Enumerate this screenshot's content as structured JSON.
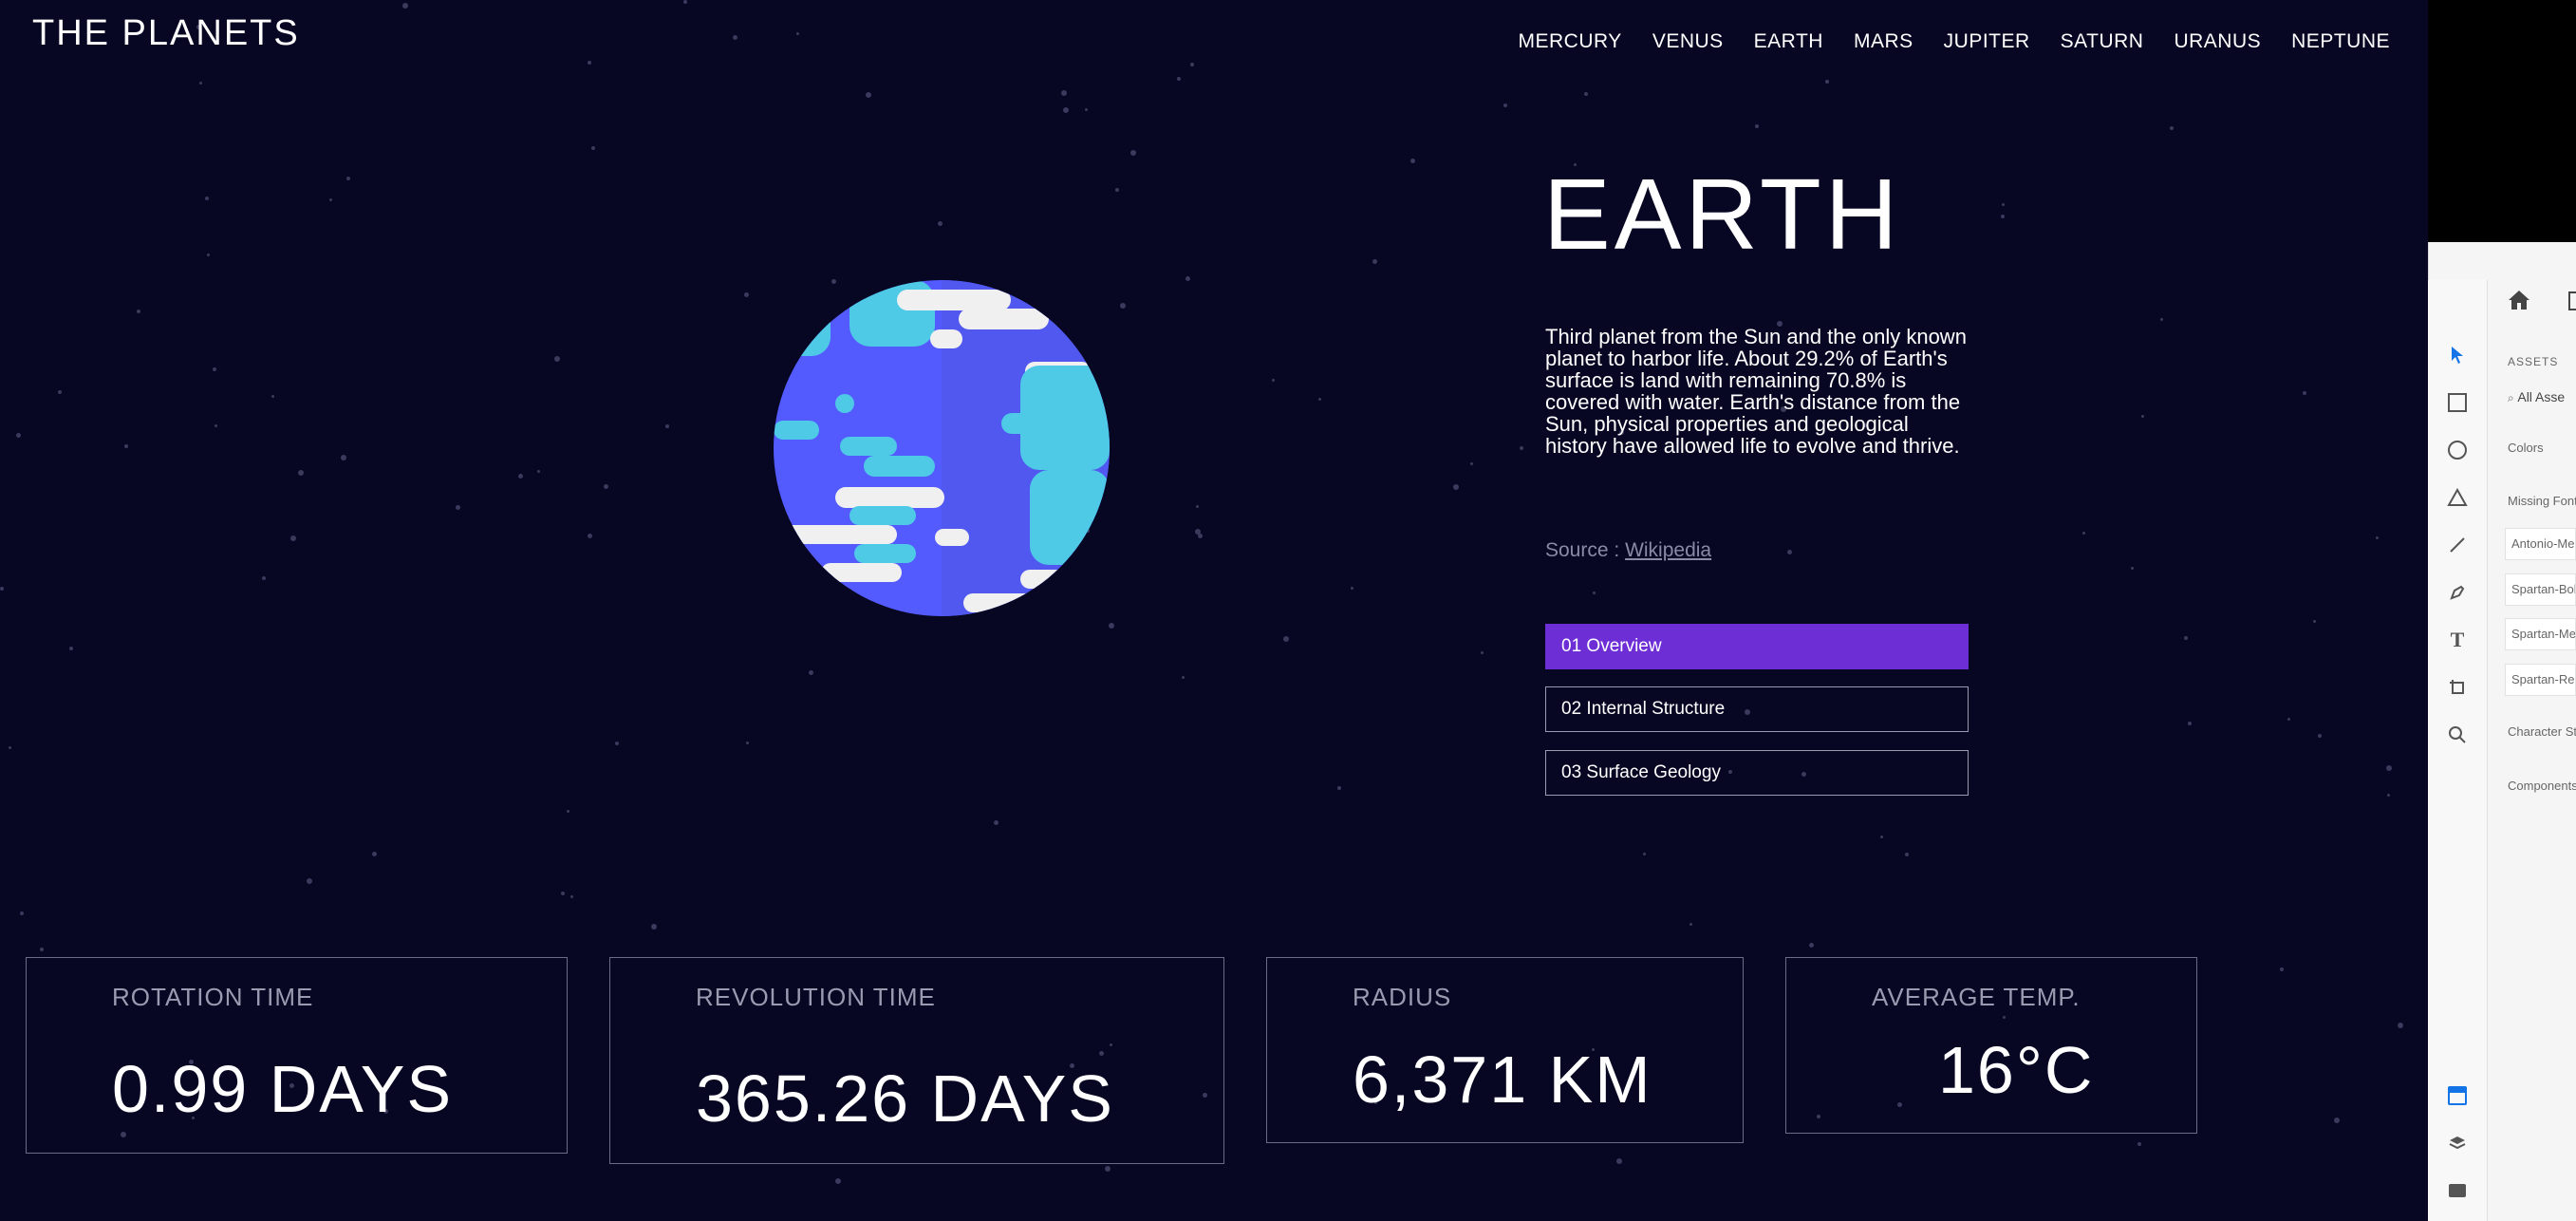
{
  "app": {
    "logo": "THE PLANETS",
    "nav": [
      "MERCURY",
      "VENUS",
      "EARTH",
      "MARS",
      "JUPITER",
      "SATURN",
      "URANUS",
      "NEPTUNE"
    ]
  },
  "planet": {
    "name": "EARTH",
    "description": "Third planet from the Sun and the only known planet to harbor life. About 29.2% of Earth's surface is land with remaining 70.8% is covered with water. Earth's distance from the Sun, physical properties and geological history have allowed life to evolve and thrive.",
    "source_label": "Source :",
    "source_link": "Wikipedia"
  },
  "tabs": [
    {
      "label": "01 Overview",
      "active": true
    },
    {
      "label": "02 Internal Structure",
      "active": false
    },
    {
      "label": "03 Surface Geology",
      "active": false
    }
  ],
  "stats": [
    {
      "label": "ROTATION TIME",
      "value": "0.99 DAYS"
    },
    {
      "label": "REVOLUTION TIME",
      "value": "365.26 DAYS"
    },
    {
      "label": "RADIUS",
      "value": "6,371 KM"
    },
    {
      "label": "AVERAGE TEMP.",
      "value": "16°C"
    }
  ],
  "assets_panel": {
    "heading": "ASSETS",
    "search_placeholder": "All Asse",
    "colors": "Colors",
    "missing_fonts": "Missing Font",
    "fonts": [
      "Antonio-Me",
      "Spartan-Bol",
      "Spartan-Me",
      "Spartan-Reg"
    ],
    "character_styles": "Character Sty",
    "components": "Components"
  },
  "colors": {
    "background": "#070724",
    "accent": "#6d2ed5",
    "earth_blue": "#545bfe",
    "earth_cyan": "#4ec9e6"
  }
}
